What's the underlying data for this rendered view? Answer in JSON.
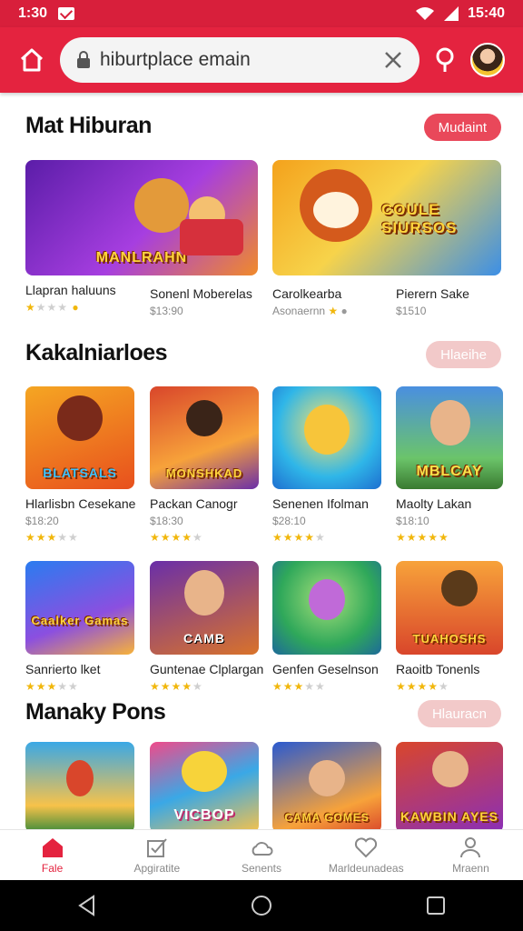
{
  "status": {
    "time": "1:30",
    "right_text": "15:40"
  },
  "search": {
    "value": "hiburtplace emain"
  },
  "sections": [
    {
      "title": "Mat Hiburan",
      "more_label": "Mudaint",
      "cards": [
        {
          "art": "MANLRAHN",
          "name": "Llapran haluuns",
          "meta": "",
          "rating": 1
        },
        {
          "art": "",
          "name": "Sonenl Moberelas",
          "meta": "$13:90",
          "rating": 0
        },
        {
          "art": "COULE SIURSOS",
          "name": "Carolkearba",
          "meta": "Asonaernn",
          "rating": 1
        },
        {
          "art": "",
          "name": "Pierern Sake",
          "meta": "$1510",
          "rating": 0
        }
      ]
    },
    {
      "title": "Kakalniarloes",
      "more_label": "Hlaeihe",
      "cards": [
        {
          "art": "BLATSALS",
          "name": "Hlarlisbn Cesekane",
          "meta": "$18:20",
          "rating": 3
        },
        {
          "art": "MONSHKAD",
          "name": "Packan Canogr",
          "meta": "$18:30",
          "rating": 4
        },
        {
          "art": "",
          "name": "Senenen Ifolman",
          "meta": "$28:10",
          "rating": 4
        },
        {
          "art": "MBLCAY",
          "name": "Maolty Lakan",
          "meta": "$18:10",
          "rating": 5
        },
        {
          "art": "Caalker Gamas",
          "name": "Sanrierto lket",
          "meta": "",
          "rating": 3
        },
        {
          "art": "CAMB",
          "name": "Guntenae Clplargan",
          "meta": "",
          "rating": 4
        },
        {
          "art": "",
          "name": "Genfen Geselnson",
          "meta": "",
          "rating": 3
        },
        {
          "art": "TUAHOSHS",
          "name": "Raoitb Tonenls",
          "meta": "",
          "rating": 4
        }
      ]
    },
    {
      "title": "Manaky Pons",
      "more_label": "Hlauracn",
      "cards": [
        {
          "art": "",
          "name": "",
          "meta": "",
          "rating": 0
        },
        {
          "art": "VICBOP",
          "name": "",
          "meta": "",
          "rating": 0
        },
        {
          "art": "CAMA GOMES",
          "name": "",
          "meta": "",
          "rating": 0
        },
        {
          "art": "KAWBIN AYES",
          "name": "",
          "meta": "",
          "rating": 0
        }
      ]
    }
  ],
  "bottom_nav": [
    {
      "label": "Fale",
      "icon": "home-icon"
    },
    {
      "label": "Apgiratite",
      "icon": "checklist-icon"
    },
    {
      "label": "Senents",
      "icon": "cloud-icon"
    },
    {
      "label": "Marldeunadeas",
      "icon": "heart-icon"
    },
    {
      "label": "Mraenn",
      "icon": "person-icon"
    }
  ],
  "colors": {
    "brand": "#e4233f",
    "status": "#d81f3b"
  }
}
